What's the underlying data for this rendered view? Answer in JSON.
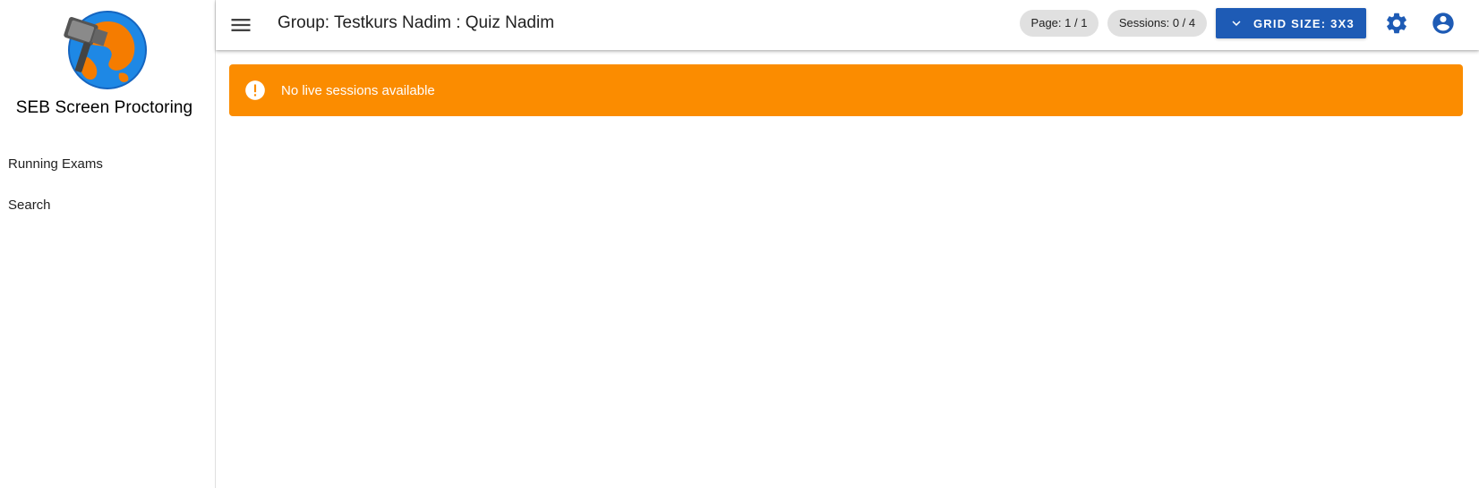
{
  "sidebar": {
    "app_title": "SEB Screen Proctoring",
    "items": [
      {
        "label": "Running Exams"
      },
      {
        "label": "Search"
      }
    ]
  },
  "header": {
    "menu_icon": "menu-icon",
    "title": "Group: Testkurs Nadim : Quiz Nadim",
    "page_chip": "Page: 1 / 1",
    "sessions_chip": "Sessions: 0 / 4",
    "grid_size_label": "GRID SIZE: 3X3",
    "grid_size_icon": "chevron-down-icon",
    "settings_icon": "gear-icon",
    "account_icon": "account-circle-icon"
  },
  "alert": {
    "icon": "alert-circle-icon",
    "message": "No live sessions available"
  },
  "colors": {
    "primary": "#1e5bb5",
    "warning": "#fb8c00",
    "chip_bg": "#e0e0e0",
    "logo_blue": "#1e88e5",
    "logo_orange": "#f57c00"
  }
}
